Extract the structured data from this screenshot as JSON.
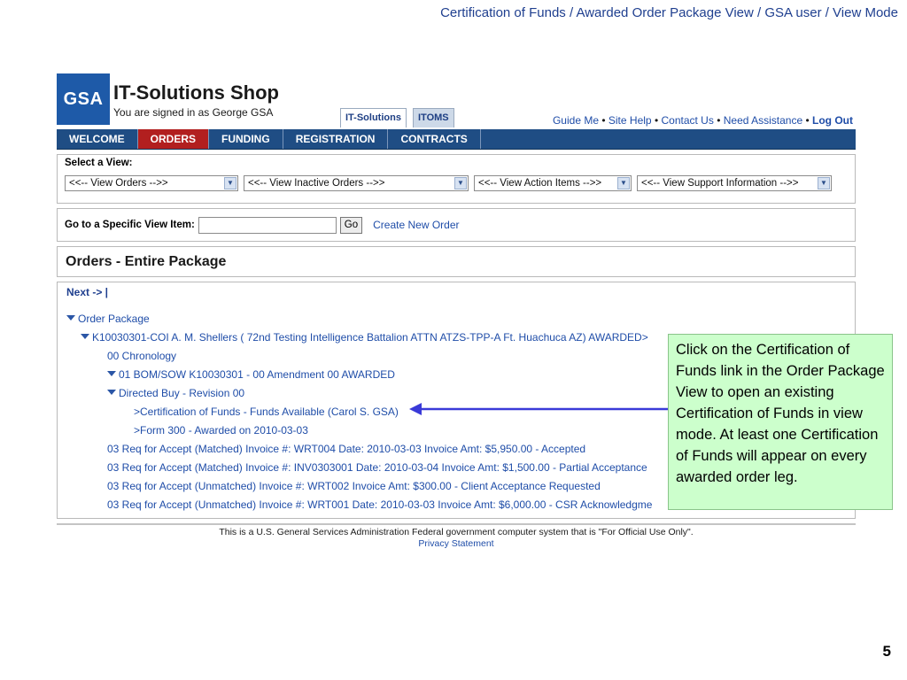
{
  "slide": {
    "title": "Certification of Funds / Awarded Order Package View / GSA user / View Mode",
    "number": "5"
  },
  "header": {
    "logo": "GSA",
    "title": "IT-Solutions Shop",
    "signed_in": "You are signed in as George GSA",
    "tabs": [
      "IT-Solutions",
      "ITOMS"
    ],
    "links": [
      "Guide Me",
      "Site Help",
      "Contact Us",
      "Need Assistance",
      "Log Out"
    ],
    "link_separator": "•"
  },
  "nav": {
    "items": [
      "WELCOME",
      "ORDERS",
      "FUNDING",
      "REGISTRATION",
      "CONTRACTS"
    ],
    "active": "ORDERS"
  },
  "views": {
    "label": "Select a View:",
    "selects": [
      "<<-- View Orders -->>",
      "<<-- View Inactive Orders -->>",
      "<<-- View Action Items -->>",
      "<<-- View Support Information -->>"
    ]
  },
  "goto": {
    "label": "Go to a Specific View Item:",
    "input_value": "",
    "button": "Go",
    "create_link": "Create New Order"
  },
  "page": {
    "heading": "Orders - Entire Package"
  },
  "tree": {
    "next": "Next -> |",
    "rows": [
      {
        "indent": 0,
        "expanded": true,
        "text": "Order Package"
      },
      {
        "indent": 1,
        "expanded": true,
        "text": "K10030301-COI A. M. Shellers  ( 72nd Testing Intelligence Battalion ATTN ATZS-TPP-A Ft. Huachuca AZ) AWARDED>"
      },
      {
        "indent": 2,
        "expanded": false,
        "text": "00 Chronology"
      },
      {
        "indent": 2,
        "expanded": true,
        "text": "01 BOM/SOW K10030301 - 00 Amendment 00 AWARDED"
      },
      {
        "indent": 3,
        "expanded": true,
        "text": "Directed Buy - Revision 00"
      },
      {
        "indent": 4,
        "expanded": false,
        "text": ">Certification of Funds - Funds Available (Carol S. GSA)"
      },
      {
        "indent": 4,
        "expanded": false,
        "text": ">Form 300 - Awarded on 2010-03-03"
      },
      {
        "indent": 2,
        "expanded": false,
        "text": "03 Req for Accept (Matched) Invoice #: WRT004 Date: 2010-03-03 Invoice Amt: $5,950.00 - Accepted"
      },
      {
        "indent": 2,
        "expanded": false,
        "text": "03 Req for Accept (Matched) Invoice #: INV0303001 Date: 2010-03-04 Invoice Amt: $1,500.00 - Partial Acceptance"
      },
      {
        "indent": 2,
        "expanded": false,
        "text": "03 Req for Accept (Unmatched) Invoice #: WRT002 Invoice Amt: $300.00 - Client Acceptance Requested"
      },
      {
        "indent": 2,
        "expanded": false,
        "text": "03 Req for Accept (Unmatched) Invoice #: WRT001 Date: 2010-03-03 Invoice Amt: $6,000.00 - CSR Acknowledgme"
      }
    ]
  },
  "footer": {
    "notice": "This is a U.S. General Services Administration Federal government computer system that is \"For Official Use Only\".",
    "privacy": "Privacy Statement"
  },
  "callout": {
    "text": "Click on the Certification of Funds link in the Order Package View to open an existing Certification of Funds in view mode.  At least one Certification of Funds will appear on every awarded order leg."
  },
  "colors": {
    "nav_bg": "#1f4d84",
    "nav_active": "#b21f1f",
    "link": "#1f4da8",
    "logo_bg": "#1e5aa8",
    "callout_bg": "#ccffcc",
    "arrow": "#3a3ad8"
  }
}
